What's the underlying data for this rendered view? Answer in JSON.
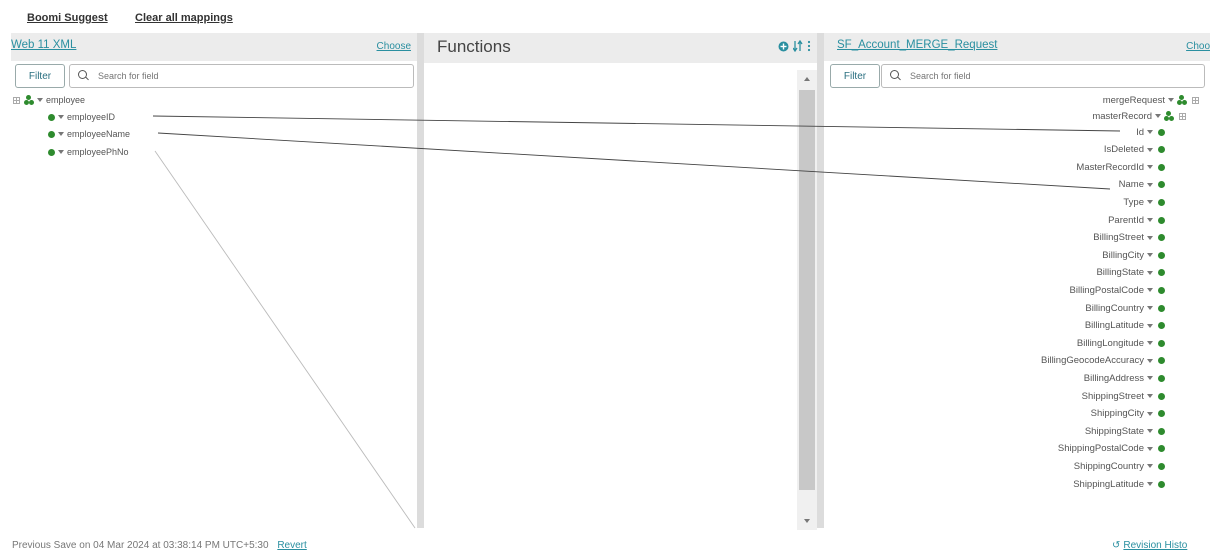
{
  "toolbar": {
    "boomi_suggest": "Boomi Suggest",
    "clear_mappings": "Clear all mappings"
  },
  "source": {
    "title": "Web 11 XML",
    "choose": "Choose",
    "filter": "Filter",
    "search_placeholder": "Search for field",
    "root": "employee",
    "fields": [
      "employeeID",
      "employeeName",
      "employeePhNo"
    ]
  },
  "functions": {
    "title": "Functions"
  },
  "destination": {
    "title": "SF_Account_MERGE_Request",
    "choose": "Choo",
    "filter": "Filter",
    "search_placeholder": "Search for field",
    "root": "mergeRequest",
    "record": "masterRecord",
    "fields": [
      "Id",
      "IsDeleted",
      "MasterRecordId",
      "Name",
      "Type",
      "ParentId",
      "BillingStreet",
      "BillingCity",
      "BillingState",
      "BillingPostalCode",
      "BillingCountry",
      "BillingLatitude",
      "BillingLongitude",
      "BillingGeocodeAccuracy",
      "BillingAddress",
      "ShippingStreet",
      "ShippingCity",
      "ShippingState",
      "ShippingPostalCode",
      "ShippingCountry",
      "ShippingLatitude"
    ]
  },
  "footer": {
    "save_info": "Previous Save on 04 Mar 2024 at 03:38:14 PM UTC+5:30",
    "revert": "Revert",
    "revision_history": "Revision Histo"
  },
  "colors": {
    "accent": "#2a8fa0",
    "node": "#2e8b2e",
    "header_bg": "#ececec"
  }
}
